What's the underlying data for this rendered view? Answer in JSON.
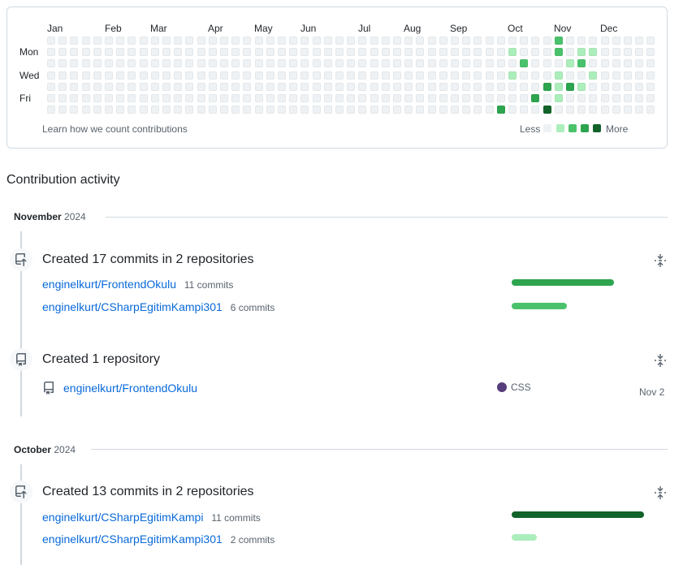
{
  "contributions": {
    "months": [
      "Jan",
      "Feb",
      "Mar",
      "Apr",
      "May",
      "Jun",
      "Jul",
      "Aug",
      "Sep",
      "Oct",
      "Nov",
      "Dec"
    ],
    "day_labels": [
      "Mon",
      "Wed",
      "Fri"
    ],
    "week_count": 53,
    "active_cells": [
      {
        "week": 44,
        "day": 0,
        "level": 2
      },
      {
        "week": 40,
        "day": 1,
        "level": 1
      },
      {
        "week": 44,
        "day": 1,
        "level": 2
      },
      {
        "week": 46,
        "day": 1,
        "level": 1
      },
      {
        "week": 47,
        "day": 1,
        "level": 1
      },
      {
        "week": 41,
        "day": 2,
        "level": 2
      },
      {
        "week": 45,
        "day": 2,
        "level": 1
      },
      {
        "week": 46,
        "day": 2,
        "level": 2
      },
      {
        "week": 40,
        "day": 3,
        "level": 1
      },
      {
        "week": 44,
        "day": 3,
        "level": 1
      },
      {
        "week": 47,
        "day": 3,
        "level": 1
      },
      {
        "week": 43,
        "day": 4,
        "level": 3
      },
      {
        "week": 44,
        "day": 4,
        "level": 1
      },
      {
        "week": 45,
        "day": 4,
        "level": 3
      },
      {
        "week": 46,
        "day": 4,
        "level": 1
      },
      {
        "week": 42,
        "day": 5,
        "level": 3
      },
      {
        "week": 44,
        "day": 5,
        "level": 1
      },
      {
        "week": 39,
        "day": 6,
        "level": 3
      },
      {
        "week": 43,
        "day": 6,
        "level": 4
      }
    ],
    "learn_link": "Learn how we count contributions",
    "legend_less": "Less",
    "legend_more": "More",
    "legend_colors": [
      "#eff2f5",
      "#aceebb",
      "#4ac26b",
      "#2da44e",
      "#116329"
    ]
  },
  "activity": {
    "title": "Contribution activity",
    "november": {
      "month": "November",
      "year": "2024",
      "commits_event": {
        "title": "Created 17 commits in 2 repositories",
        "repos": [
          {
            "name": "enginelkurt/FrontendOkulu",
            "count": "11 commits",
            "fraction": 0.77,
            "color": "#2da44e"
          },
          {
            "name": "enginelkurt/CSharpEgitimKampi301",
            "count": "6 commits",
            "fraction": 0.42,
            "color": "#4ac26b"
          }
        ]
      },
      "repo_event": {
        "title": "Created 1 repository",
        "repo": "enginelkurt/FrontendOkulu",
        "language": "CSS",
        "language_color": "#563d7c",
        "date": "Nov 2"
      }
    },
    "october": {
      "month": "October",
      "year": "2024",
      "commits_event": {
        "title": "Created 13 commits in 2 repositories",
        "repos": [
          {
            "name": "enginelkurt/CSharpEgitimKampi",
            "count": "11 commits",
            "fraction": 1.0,
            "color": "#116329"
          },
          {
            "name": "enginelkurt/CSharpEgitimKampi301",
            "count": "2 commits",
            "fraction": 0.19,
            "color": "#aceebb"
          }
        ]
      }
    }
  }
}
